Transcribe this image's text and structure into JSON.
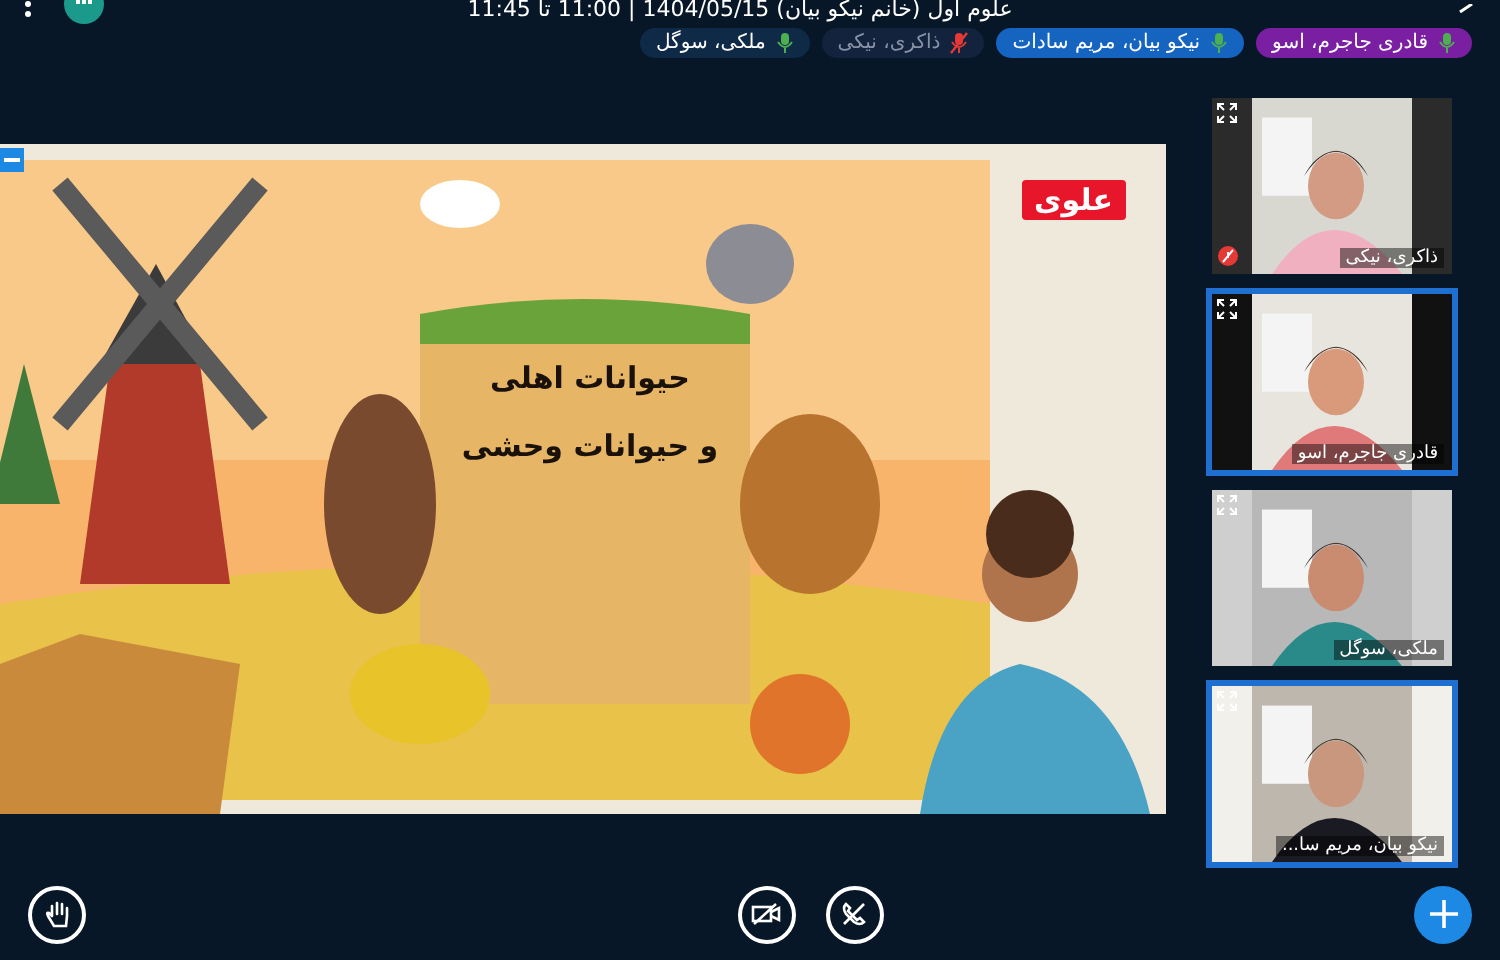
{
  "header": {
    "title": "علوم اول (خانم نیکو بیان) 1404/05/15 | 11:00 تا 11:45"
  },
  "speakers": [
    {
      "name": "قادری جاجرم، اسو",
      "color": "#7a1fa2",
      "muted": false
    },
    {
      "name": "نیکو بیان، مریم سادات",
      "color": "#1565c0",
      "muted": false
    },
    {
      "name": "ذاکری، نیکی",
      "color": "#13233d",
      "muted": true
    },
    {
      "name": "ملکی، سوگل",
      "color": "#0f2a47",
      "muted": false
    }
  ],
  "slide": {
    "badge": "علوی",
    "sign_lines": [
      "حیوانات اهلی",
      "و حیوانات وحشی"
    ]
  },
  "videos": [
    {
      "name": "ذاکری، نیکی",
      "speaking": false,
      "muted": true
    },
    {
      "name": "قادری جاجرم، اسو",
      "speaking": true,
      "muted": false
    },
    {
      "name": "ملکی، سوگل",
      "speaking": false,
      "muted": false
    },
    {
      "name": "نیکو بیان، مریم سا...",
      "speaking": true,
      "muted": false
    }
  ]
}
